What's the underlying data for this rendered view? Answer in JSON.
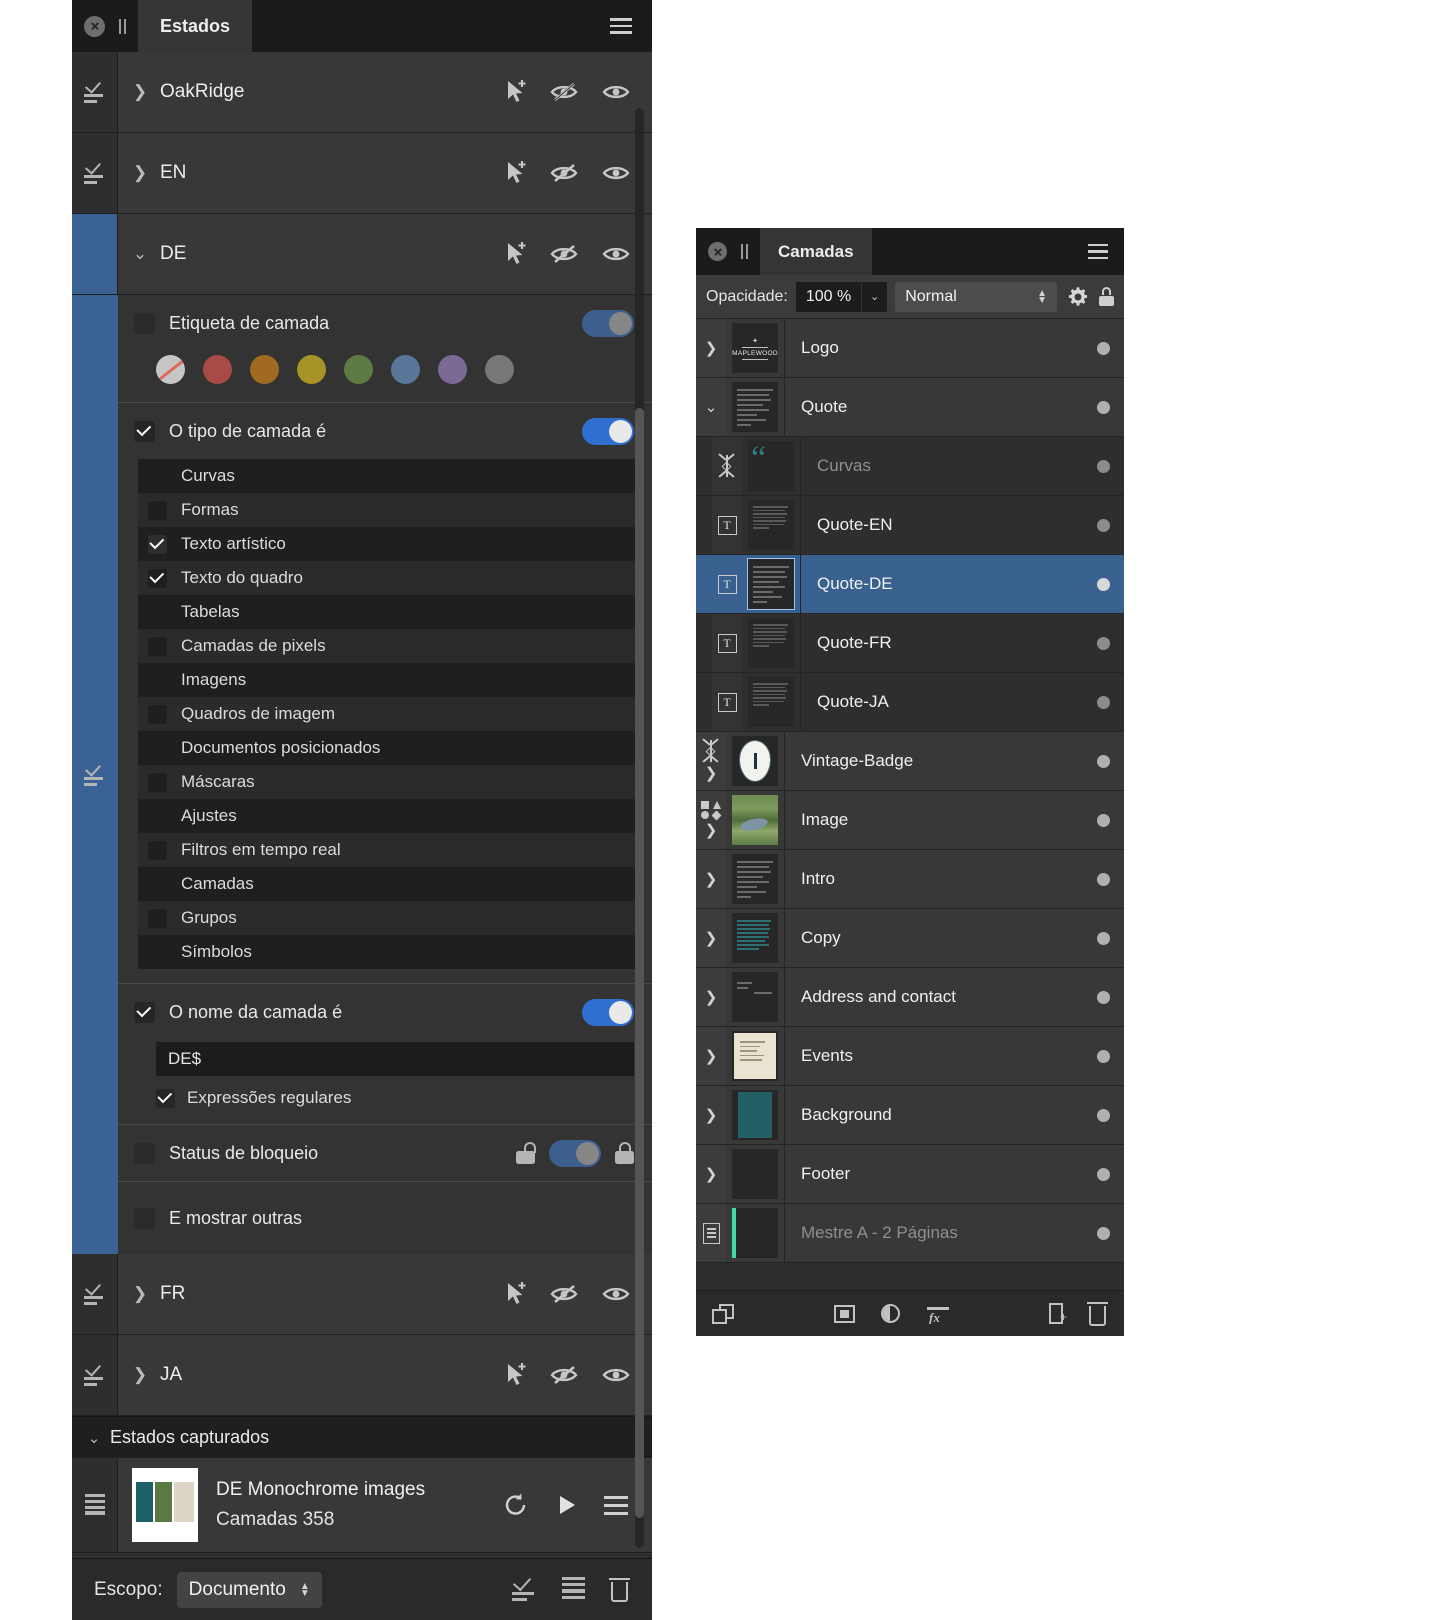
{
  "estados_panel": {
    "tab_label": "Estados",
    "close_icon": "close-icon",
    "grip_icon": "grip-icon",
    "menu_icon": "hamburger-menu-icon",
    "state_rows": [
      {
        "name": "OakRidge",
        "expanded": false,
        "selected": false
      },
      {
        "name": "EN",
        "expanded": false,
        "selected": false
      },
      {
        "name": "DE",
        "expanded": true,
        "selected": true
      }
    ],
    "state_rows_bottom": [
      {
        "name": "FR",
        "expanded": false,
        "selected": false
      },
      {
        "name": "JA",
        "expanded": false,
        "selected": false
      }
    ],
    "row_icons": [
      "add-cursor-icon",
      "hide-eye-icon",
      "show-eye-icon"
    ],
    "conditions": {
      "layer_label": {
        "label": "Etiqueta de camada",
        "checked": false,
        "toggle_on": true,
        "toggle_dim": true,
        "swatches": [
          {
            "name": "none",
            "color": "#c6c6c6"
          },
          {
            "name": "red",
            "color": "#a84b47"
          },
          {
            "name": "orange",
            "color": "#a06b20"
          },
          {
            "name": "yellow",
            "color": "#a89327"
          },
          {
            "name": "green",
            "color": "#5c7b42"
          },
          {
            "name": "blue",
            "color": "#5a7799"
          },
          {
            "name": "purple",
            "color": "#7a6b96"
          },
          {
            "name": "gray",
            "color": "#777777"
          }
        ]
      },
      "layer_type": {
        "label": "O tipo de camada é",
        "checked": true,
        "toggle_on": true,
        "items": [
          {
            "label": "Curvas",
            "checked": false,
            "box": false
          },
          {
            "label": "Formas",
            "checked": false,
            "box": true
          },
          {
            "label": "Texto artístico",
            "checked": true,
            "box": true
          },
          {
            "label": "Texto do quadro",
            "checked": true,
            "box": true
          },
          {
            "label": "Tabelas",
            "checked": false,
            "box": false
          },
          {
            "label": "Camadas de pixels",
            "checked": false,
            "box": true
          },
          {
            "label": "Imagens",
            "checked": false,
            "box": false
          },
          {
            "label": "Quadros de imagem",
            "checked": false,
            "box": true
          },
          {
            "label": "Documentos posicionados",
            "checked": false,
            "box": false
          },
          {
            "label": "Máscaras",
            "checked": false,
            "box": true
          },
          {
            "label": "Ajustes",
            "checked": false,
            "box": false
          },
          {
            "label": "Filtros em tempo real",
            "checked": false,
            "box": true
          },
          {
            "label": "Camadas",
            "checked": false,
            "box": false
          },
          {
            "label": "Grupos",
            "checked": false,
            "box": true
          },
          {
            "label": "Símbolos",
            "checked": false,
            "box": false
          }
        ]
      },
      "layer_name": {
        "label": "O nome da camada é",
        "checked": true,
        "toggle_on": true,
        "value": "DE$",
        "regex_label": "Expressões regulares",
        "regex_checked": true
      },
      "lock_status": {
        "label": "Status de bloqueio",
        "checked": false,
        "toggle_on": true,
        "toggle_dim": true,
        "unlock_icon": "unlock-icon",
        "lock_icon": "lock-icon"
      },
      "show_others": {
        "label": "E mostrar outras",
        "checked": false
      }
    },
    "captured": {
      "header": "Estados capturados",
      "item_title": "DE Monochrome images",
      "item_sub": "Camadas 358",
      "actions": [
        "reset-icon",
        "play-icon",
        "menu-icon"
      ]
    },
    "scope": {
      "label": "Escopo:",
      "value": "Documento",
      "icons": [
        "capture-state-icon",
        "list-icon",
        "trash-icon"
      ]
    }
  },
  "camadas_panel": {
    "tab_label": "Camadas",
    "close_icon": "close-icon",
    "grip_icon": "grip-icon",
    "menu_icon": "hamburger-menu-icon",
    "opacity_label": "Opacidade:",
    "opacity_value": "100 %",
    "blend_mode": "Normal",
    "gear_icon": "gear-icon",
    "lock_icon": "lock-icon",
    "layers": [
      {
        "name": "Logo",
        "type": "group",
        "indent": 0,
        "disclosure": "right",
        "thumb": "logo",
        "selected": false,
        "dim": false
      },
      {
        "name": "Quote",
        "type": "group",
        "indent": 0,
        "disclosure": "down",
        "thumb": "text-lines",
        "selected": false,
        "dim": false
      },
      {
        "name": "Curvas",
        "type": "curve",
        "indent": 1,
        "disclosure": "none",
        "thumb": "quote-marks",
        "selected": false,
        "dim": true
      },
      {
        "name": "Quote-EN",
        "type": "text",
        "indent": 1,
        "disclosure": "none",
        "thumb": "tiny-text",
        "selected": false,
        "dim": false
      },
      {
        "name": "Quote-DE",
        "type": "text",
        "indent": 1,
        "disclosure": "none",
        "thumb": "text-lines",
        "selected": true,
        "dim": false
      },
      {
        "name": "Quote-FR",
        "type": "text",
        "indent": 1,
        "disclosure": "none",
        "thumb": "tiny-text",
        "selected": false,
        "dim": false
      },
      {
        "name": "Quote-JA",
        "type": "text",
        "indent": 1,
        "disclosure": "none",
        "thumb": "tiny-text",
        "selected": false,
        "dim": false
      },
      {
        "name": "Vintage-Badge",
        "type": "curve",
        "indent": 0,
        "disclosure": "right",
        "thumb": "badge",
        "selected": false,
        "dim": false
      },
      {
        "name": "Image",
        "type": "shapes",
        "indent": 0,
        "disclosure": "right",
        "thumb": "photo",
        "selected": false,
        "dim": false
      },
      {
        "name": "Intro",
        "type": "group",
        "indent": 0,
        "disclosure": "right",
        "thumb": "text-lines",
        "selected": false,
        "dim": false
      },
      {
        "name": "Copy",
        "type": "group",
        "indent": 0,
        "disclosure": "right",
        "thumb": "teal-text",
        "selected": false,
        "dim": false
      },
      {
        "name": "Address and contact",
        "type": "group",
        "indent": 0,
        "disclosure": "right",
        "thumb": "sparse-text",
        "selected": false,
        "dim": false
      },
      {
        "name": "Events",
        "type": "group",
        "indent": 0,
        "disclosure": "right",
        "thumb": "cream-page",
        "selected": false,
        "dim": false
      },
      {
        "name": "Background",
        "type": "group",
        "indent": 0,
        "disclosure": "right",
        "thumb": "teal-fill",
        "selected": false,
        "dim": false
      },
      {
        "name": "Footer",
        "type": "group",
        "indent": 0,
        "disclosure": "right",
        "thumb": "dark",
        "selected": false,
        "dim": false
      },
      {
        "name": "Mestre A - 2 Páginas",
        "type": "master",
        "indent": 0,
        "disclosure": "none",
        "thumb": "master",
        "selected": false,
        "dim": true
      }
    ],
    "toolbar_icons": [
      "stack-layers-icon",
      "mask-icon",
      "adjustment-icon",
      "fx-icon",
      "new-layer-icon",
      "delete-layer-icon"
    ],
    "fx_label": "fx"
  }
}
